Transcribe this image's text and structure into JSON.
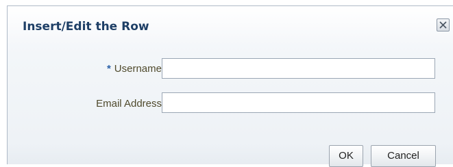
{
  "dialog": {
    "title": "Insert/Edit the Row",
    "close_icon": "close-icon"
  },
  "form": {
    "username": {
      "required_marker": "*",
      "label": "Username",
      "value": ""
    },
    "email": {
      "label": "Email Address",
      "value": ""
    }
  },
  "buttons": {
    "ok_label": "OK",
    "cancel_label": "Cancel"
  }
}
